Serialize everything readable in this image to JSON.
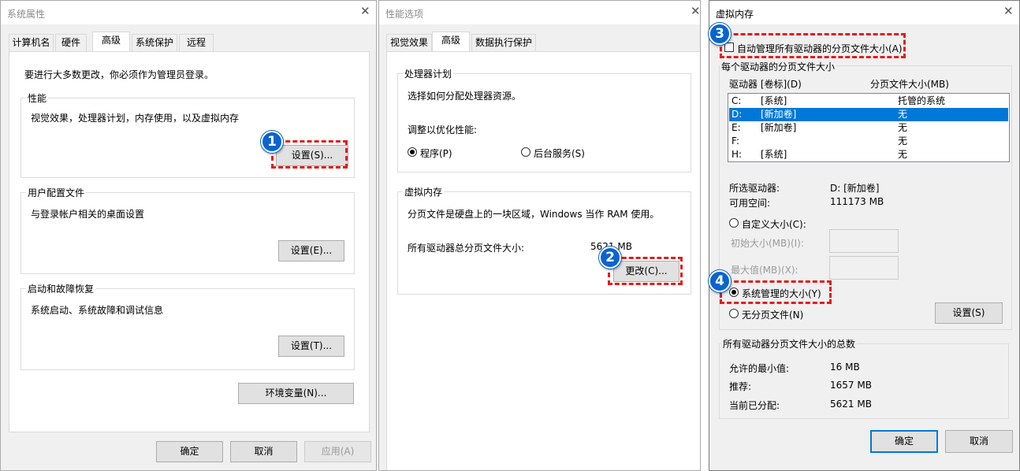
{
  "system_properties": {
    "title": "系统属性",
    "tabs": [
      "计算机名",
      "硬件",
      "高级",
      "系统保护",
      "远程"
    ],
    "admin_note": "要进行大多数更改，你必须作为管理员登录。",
    "performance": {
      "label": "性能",
      "description": "视觉效果，处理器计划，内存使用，以及虚拟内存",
      "button": "设置(S)..."
    },
    "user_profiles": {
      "label": "用户配置文件",
      "description": "与登录帐户相关的桌面设置",
      "button": "设置(E)..."
    },
    "startup_recovery": {
      "label": "启动和故障恢复",
      "description": "系统启动、系统故障和调试信息",
      "button": "设置(T)..."
    },
    "env_button": "环境变量(N)...",
    "ok": "确定",
    "cancel": "取消",
    "apply": "应用(A)"
  },
  "performance_options": {
    "title": "性能选项",
    "tabs": [
      "视觉效果",
      "高级",
      "数据执行保护"
    ],
    "processor": {
      "label": "处理器计划",
      "description": "选择如何分配处理器资源。",
      "adjust_label": "调整以优化性能:",
      "programs": "程序(P)",
      "background": "后台服务(S)"
    },
    "virtual_memory": {
      "label": "虚拟内存",
      "description": "分页文件是硬盘上的一块区域，Windows 当作 RAM 使用。",
      "total_label": "所有驱动器总分页文件大小:",
      "total_value": "5621 MB",
      "change_button": "更改(C)..."
    }
  },
  "virtual_memory": {
    "title": "虚拟内存",
    "auto_manage": "自动管理所有驱动器的分页文件大小(A)",
    "per_drive_label": "每个驱动器的分页文件大小",
    "col_drive": "驱动器 [卷标](D)",
    "col_size": "分页文件大小(MB)",
    "drives": [
      {
        "letter": "C:",
        "label": "[系统]",
        "size": "托管的系统"
      },
      {
        "letter": "D:",
        "label": "[新加卷]",
        "size": "无"
      },
      {
        "letter": "E:",
        "label": "[新加卷]",
        "size": "无"
      },
      {
        "letter": "F:",
        "label": "",
        "size": "无"
      },
      {
        "letter": "H:",
        "label": "[系统]",
        "size": "无"
      }
    ],
    "selected_drive_label": "所选驱动器:",
    "selected_drive_value": "D:  [新加卷]",
    "free_space_label": "可用空间:",
    "free_space_value": "111173 MB",
    "custom_size": "自定义大小(C):",
    "initial_size": "初始大小(MB)(I):",
    "max_size": "最大值(MB)(X):",
    "system_managed": "系统管理的大小(Y)",
    "no_paging": "无分页文件(N)",
    "set_button": "设置(S)",
    "totals_label": "所有驱动器分页文件大小的总数",
    "min_allowed_label": "允许的最小值:",
    "min_allowed_value": "16 MB",
    "recommended_label": "推荐:",
    "recommended_value": "1657 MB",
    "current_label": "当前已分配:",
    "current_value": "5621 MB",
    "ok": "确定",
    "cancel": "取消"
  },
  "steps": [
    "1",
    "2",
    "3",
    "4"
  ],
  "colors": {
    "callout_red": "#e11d1d",
    "badge_blue": "#0a64cf",
    "selection_blue": "#0078d7"
  }
}
